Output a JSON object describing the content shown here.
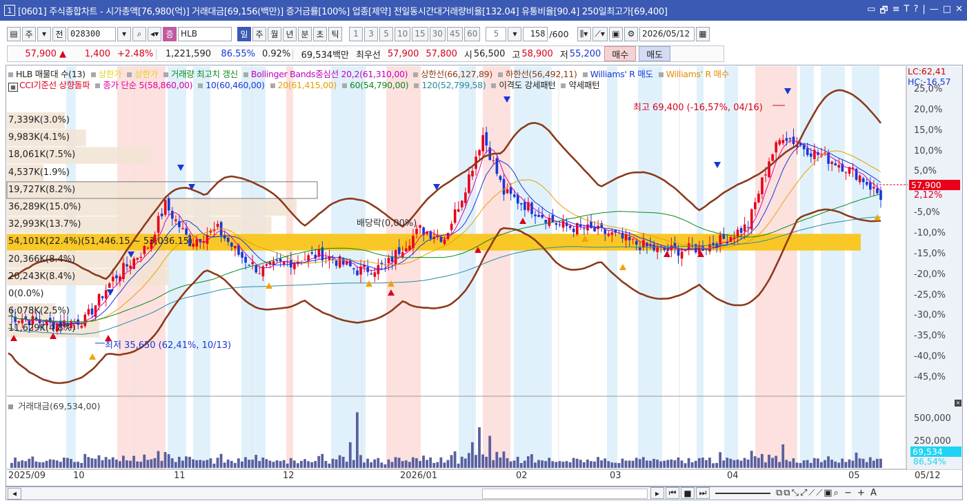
{
  "window": {
    "number": "1",
    "title": "[0601] 주식종합차트 - 시가총액[76,980(억)] 거래대금[69,156(백만)] 증거금률[100%] 업종[제약] 전일동시간대거래량비율[132.04] 유통비율[90.4] 250일최고가[69,400]",
    "controls": [
      "▭",
      "🗗",
      "≡",
      "T",
      "?",
      "|",
      "—",
      "□",
      "✕"
    ]
  },
  "toolbar": {
    "market_tab": "주",
    "all_label": "전",
    "code": "028300",
    "tag": "증",
    "name": "HLB",
    "periods": [
      "일",
      "주",
      "월",
      "년",
      "분",
      "초",
      "틱"
    ],
    "active_period": "일",
    "minute_options": [
      "1",
      "3",
      "5",
      "10",
      "15",
      "30",
      "45",
      "60"
    ],
    "count": "5",
    "range": "158",
    "range_total": "/600",
    "date": "2026/05/12"
  },
  "quote": {
    "price": "57,900",
    "change_arrow": "▲",
    "change": "1,400",
    "change_pct": "+2.48%",
    "volume": "1,221,590",
    "vol_ratio": "86.55%",
    "turnover": "0.92%",
    "amount": "69,534백만",
    "best_label": "최우선",
    "ask": "57,900",
    "bid": "57,800",
    "open_label": "시",
    "open": "56,500",
    "high_label": "고",
    "high": "58,900",
    "low_label": "저",
    "low": "55,200",
    "buy_label": "매수",
    "sell_label": "매도"
  },
  "legend": {
    "line1": [
      {
        "text": "HLB 매물대 수(13)",
        "color": "#222222"
      },
      {
        "text": "상한가",
        "color": "#e6d21a"
      },
      {
        "text": "상한가",
        "color": "#e6d21a"
      },
      {
        "text": "거래량 최고치 갱신",
        "color": "#0a8a1a"
      },
      {
        "text": "Bollinger Bands중심선 20,2(61,310,00)",
        "color": "#c000c0"
      },
      {
        "text": "상한선(66,127,89)",
        "color": "#8b3a1a"
      },
      {
        "text": "하한선(56,492,11)",
        "color": "#8b3a1a"
      },
      {
        "text": "Williams' R 매도",
        "color": "#1737d6"
      },
      {
        "text": "Williams' R 매수",
        "color": "#e68a00"
      }
    ],
    "line2": [
      {
        "text": "CCI기준선 상향돌파",
        "color": "#d9001b"
      },
      {
        "text": "종가 단순 5(58,860,00)",
        "color": "#e000a0"
      },
      {
        "text": "10(60,460,00)",
        "color": "#1737d6"
      },
      {
        "text": "20(61,415,00)",
        "color": "#e6a000"
      },
      {
        "text": "60(54,790,00)",
        "color": "#0a8a1a"
      },
      {
        "text": "120(52,799,58)",
        "color": "#2a8aa0"
      },
      {
        "text": "이격도 강세패턴",
        "color": "#222222"
      },
      {
        "text": "약세패턴",
        "color": "#222222"
      }
    ]
  },
  "volume_profile": [
    {
      "label": "7,339K(3.0%)",
      "pct": 3.0
    },
    {
      "label": "9,983K(4.1%)",
      "pct": 4.1
    },
    {
      "label": "18,061K(7.5%)",
      "pct": 7.5
    },
    {
      "label": "4,537K(1.9%)",
      "pct": 1.9
    },
    {
      "label": "19,727K(8.2%)",
      "pct": 8.2
    },
    {
      "label": "36,289K(15.0%)",
      "pct": 15.0
    },
    {
      "label": "32,993K(13.7%)",
      "pct": 13.7
    },
    {
      "label": "54,101K(22.4%)(51,446.15 ~ 53,036.15)",
      "pct": 22.4
    },
    {
      "label": "20,366K(8.4%)",
      "pct": 8.4
    },
    {
      "label": "20,243K(8.4%)",
      "pct": 8.4
    },
    {
      "label": "0(0.0%)",
      "pct": 0.0
    },
    {
      "label": "6,078K(2.5%)",
      "pct": 2.5
    },
    {
      "label": "11,629K(4.8%)",
      "pct": 4.8
    }
  ],
  "annotations": {
    "high": "최고 69,400 (-16,57%, 04/16)",
    "low": "최저 35,650 (62,41%, 10/13)",
    "dividend": "배당락(0,00%)"
  },
  "right_axis": {
    "lc": "LC:62,41",
    "hc": "HC:-16,57",
    "ticks": [
      "25,0%",
      "20,0%",
      "15,0%",
      "10,0%",
      "5,0%",
      "-5,0%",
      "-10,0%",
      "-15,0%",
      "-20,0%",
      "-25,0%",
      "-30,0%",
      "-35,0%",
      "-40,0%",
      "-45,0%"
    ],
    "current_price": "57,900",
    "current_pct": "2,12%"
  },
  "volume_pane": {
    "legend": "거래대금(69,534,00)",
    "ticks": [
      "500,000",
      "250,000"
    ],
    "current": "69,534",
    "current_pct": "86,54%"
  },
  "date_axis": {
    "labels": [
      "2025/09",
      "10",
      "11",
      "12",
      "2026/01",
      "02",
      "03",
      "04",
      "05"
    ],
    "current": "05/12"
  },
  "colors": {
    "up": "#e8001a",
    "down": "#1737d6",
    "bollinger": "#8b3a1a",
    "band_pink": "#fde1df",
    "band_blue": "#e0f1fb",
    "vp_fill": "#f1e3d3",
    "vp_max": "#f9c51a"
  }
}
